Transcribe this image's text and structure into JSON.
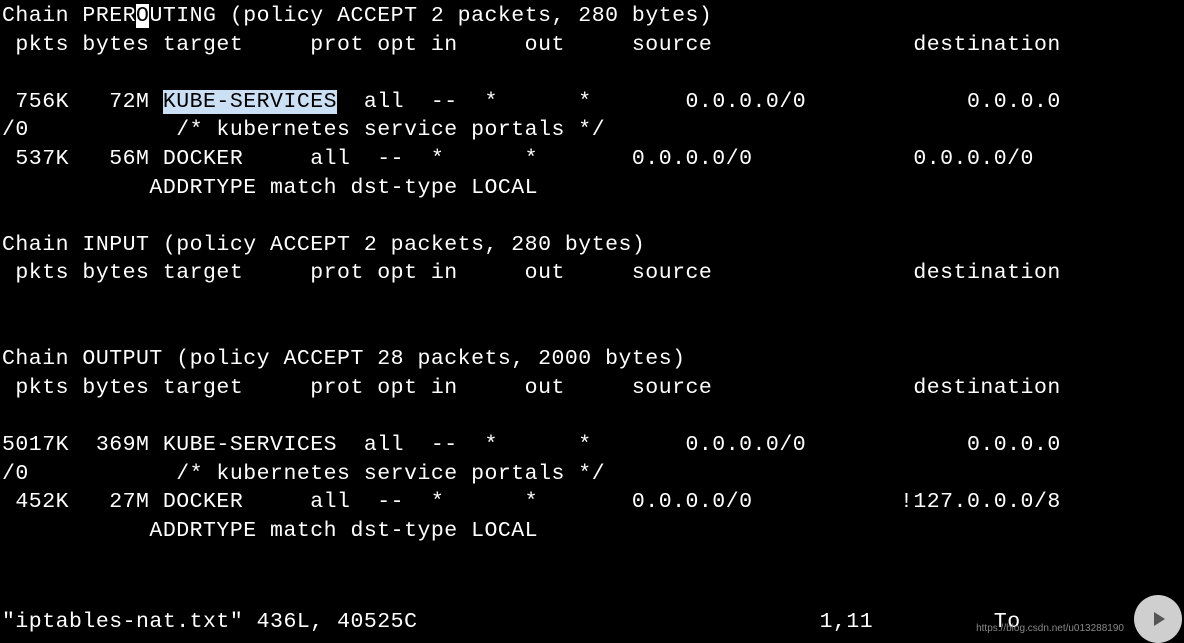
{
  "chains": {
    "prerouting": {
      "header_pre": "Chain PRER",
      "header_cursor": "O",
      "header_post": "UTING (policy ACCEPT 2 packets, 280 bytes)",
      "cols": " pkts bytes target     prot opt in     out     source               destination",
      "rules": [
        {
          "row1_a": " 756K   72M ",
          "row1_hl": "KUBE-SERVICES",
          "row1_b": "  all  --  *      *       0.0.0.0/0            0.0.0.0",
          "row2": "/0           /* kubernetes service portals */"
        },
        {
          "row1": " 537K   56M DOCKER     all  --  *      *       0.0.0.0/0            0.0.0.0/0",
          "row2": "           ADDRTYPE match dst-type LOCAL"
        }
      ]
    },
    "input": {
      "header": "Chain INPUT (policy ACCEPT 2 packets, 280 bytes)",
      "cols": " pkts bytes target     prot opt in     out     source               destination"
    },
    "output": {
      "header": "Chain OUTPUT (policy ACCEPT 28 packets, 2000 bytes)",
      "cols": " pkts bytes target     prot opt in     out     source               destination",
      "rules": [
        {
          "row1": "5017K  369M KUBE-SERVICES  all  --  *      *       0.0.0.0/0            0.0.0.0",
          "row2": "/0           /* kubernetes service portals */"
        },
        {
          "row1": " 452K   27M DOCKER     all  --  *      *       0.0.0.0/0           !127.0.0.0/8",
          "row2": "           ADDRTYPE match dst-type LOCAL"
        }
      ]
    }
  },
  "status": {
    "file": "\"iptables-nat.txt\"",
    "size": "436L, 40525C",
    "pos": "1,11",
    "scroll": "To"
  },
  "watermark": "https://blog.csdn.net/u013288190"
}
